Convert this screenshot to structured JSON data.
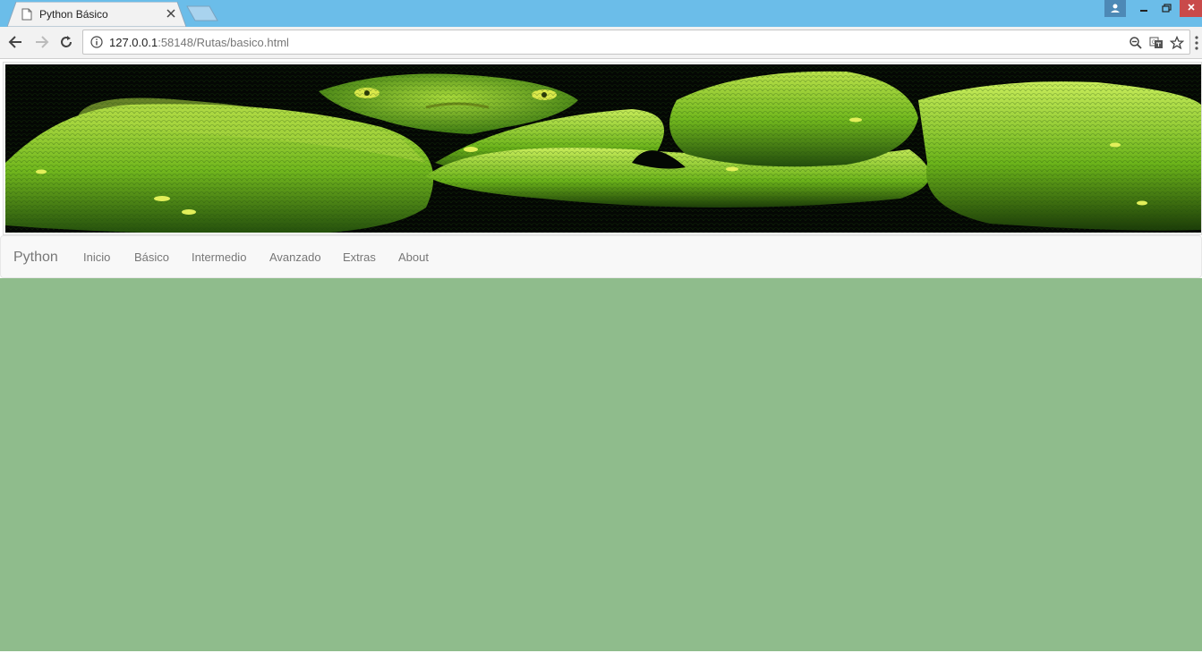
{
  "browser": {
    "tab_title": "Python Básico",
    "url_host": "127.0.0.1",
    "url_path": ":58148/Rutas/basico.html"
  },
  "navbar": {
    "brand": "Python",
    "links": [
      "Inicio",
      "Básico",
      "Intermedio",
      "Avanzado",
      "Extras",
      "About"
    ]
  },
  "colors": {
    "titlebar": "#6bbde9",
    "content_bg": "#8fbc8c",
    "navbar_bg": "#f8f8f8"
  }
}
